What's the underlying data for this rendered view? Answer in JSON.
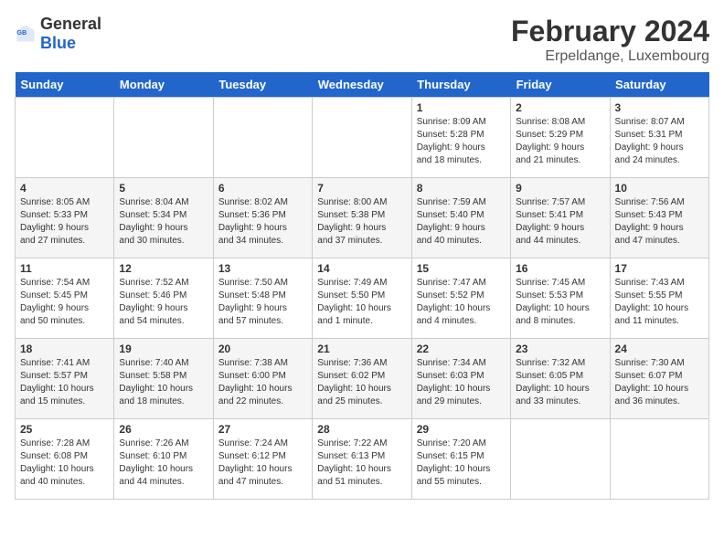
{
  "header": {
    "logo_general": "General",
    "logo_blue": "Blue",
    "main_title": "February 2024",
    "subtitle": "Erpeldange, Luxembourg"
  },
  "days_of_week": [
    "Sunday",
    "Monday",
    "Tuesday",
    "Wednesday",
    "Thursday",
    "Friday",
    "Saturday"
  ],
  "weeks": [
    [
      {
        "day": "",
        "info": ""
      },
      {
        "day": "",
        "info": ""
      },
      {
        "day": "",
        "info": ""
      },
      {
        "day": "",
        "info": ""
      },
      {
        "day": "1",
        "info": "Sunrise: 8:09 AM\nSunset: 5:28 PM\nDaylight: 9 hours\nand 18 minutes."
      },
      {
        "day": "2",
        "info": "Sunrise: 8:08 AM\nSunset: 5:29 PM\nDaylight: 9 hours\nand 21 minutes."
      },
      {
        "day": "3",
        "info": "Sunrise: 8:07 AM\nSunset: 5:31 PM\nDaylight: 9 hours\nand 24 minutes."
      }
    ],
    [
      {
        "day": "4",
        "info": "Sunrise: 8:05 AM\nSunset: 5:33 PM\nDaylight: 9 hours\nand 27 minutes."
      },
      {
        "day": "5",
        "info": "Sunrise: 8:04 AM\nSunset: 5:34 PM\nDaylight: 9 hours\nand 30 minutes."
      },
      {
        "day": "6",
        "info": "Sunrise: 8:02 AM\nSunset: 5:36 PM\nDaylight: 9 hours\nand 34 minutes."
      },
      {
        "day": "7",
        "info": "Sunrise: 8:00 AM\nSunset: 5:38 PM\nDaylight: 9 hours\nand 37 minutes."
      },
      {
        "day": "8",
        "info": "Sunrise: 7:59 AM\nSunset: 5:40 PM\nDaylight: 9 hours\nand 40 minutes."
      },
      {
        "day": "9",
        "info": "Sunrise: 7:57 AM\nSunset: 5:41 PM\nDaylight: 9 hours\nand 44 minutes."
      },
      {
        "day": "10",
        "info": "Sunrise: 7:56 AM\nSunset: 5:43 PM\nDaylight: 9 hours\nand 47 minutes."
      }
    ],
    [
      {
        "day": "11",
        "info": "Sunrise: 7:54 AM\nSunset: 5:45 PM\nDaylight: 9 hours\nand 50 minutes."
      },
      {
        "day": "12",
        "info": "Sunrise: 7:52 AM\nSunset: 5:46 PM\nDaylight: 9 hours\nand 54 minutes."
      },
      {
        "day": "13",
        "info": "Sunrise: 7:50 AM\nSunset: 5:48 PM\nDaylight: 9 hours\nand 57 minutes."
      },
      {
        "day": "14",
        "info": "Sunrise: 7:49 AM\nSunset: 5:50 PM\nDaylight: 10 hours\nand 1 minute."
      },
      {
        "day": "15",
        "info": "Sunrise: 7:47 AM\nSunset: 5:52 PM\nDaylight: 10 hours\nand 4 minutes."
      },
      {
        "day": "16",
        "info": "Sunrise: 7:45 AM\nSunset: 5:53 PM\nDaylight: 10 hours\nand 8 minutes."
      },
      {
        "day": "17",
        "info": "Sunrise: 7:43 AM\nSunset: 5:55 PM\nDaylight: 10 hours\nand 11 minutes."
      }
    ],
    [
      {
        "day": "18",
        "info": "Sunrise: 7:41 AM\nSunset: 5:57 PM\nDaylight: 10 hours\nand 15 minutes."
      },
      {
        "day": "19",
        "info": "Sunrise: 7:40 AM\nSunset: 5:58 PM\nDaylight: 10 hours\nand 18 minutes."
      },
      {
        "day": "20",
        "info": "Sunrise: 7:38 AM\nSunset: 6:00 PM\nDaylight: 10 hours\nand 22 minutes."
      },
      {
        "day": "21",
        "info": "Sunrise: 7:36 AM\nSunset: 6:02 PM\nDaylight: 10 hours\nand 25 minutes."
      },
      {
        "day": "22",
        "info": "Sunrise: 7:34 AM\nSunset: 6:03 PM\nDaylight: 10 hours\nand 29 minutes."
      },
      {
        "day": "23",
        "info": "Sunrise: 7:32 AM\nSunset: 6:05 PM\nDaylight: 10 hours\nand 33 minutes."
      },
      {
        "day": "24",
        "info": "Sunrise: 7:30 AM\nSunset: 6:07 PM\nDaylight: 10 hours\nand 36 minutes."
      }
    ],
    [
      {
        "day": "25",
        "info": "Sunrise: 7:28 AM\nSunset: 6:08 PM\nDaylight: 10 hours\nand 40 minutes."
      },
      {
        "day": "26",
        "info": "Sunrise: 7:26 AM\nSunset: 6:10 PM\nDaylight: 10 hours\nand 44 minutes."
      },
      {
        "day": "27",
        "info": "Sunrise: 7:24 AM\nSunset: 6:12 PM\nDaylight: 10 hours\nand 47 minutes."
      },
      {
        "day": "28",
        "info": "Sunrise: 7:22 AM\nSunset: 6:13 PM\nDaylight: 10 hours\nand 51 minutes."
      },
      {
        "day": "29",
        "info": "Sunrise: 7:20 AM\nSunset: 6:15 PM\nDaylight: 10 hours\nand 55 minutes."
      },
      {
        "day": "",
        "info": ""
      },
      {
        "day": "",
        "info": ""
      }
    ]
  ]
}
